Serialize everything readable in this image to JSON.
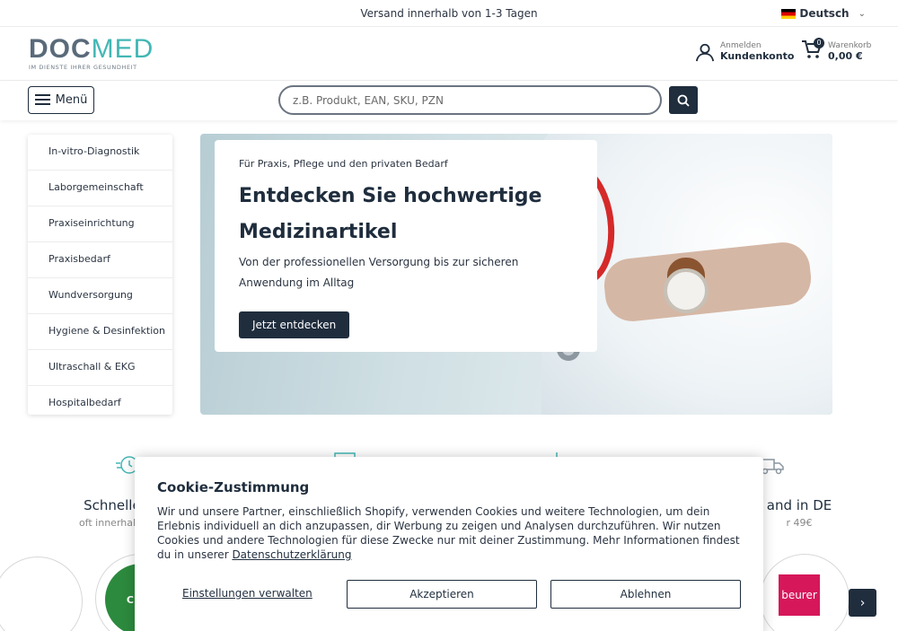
{
  "topbar": {
    "shipping": "Versand innerhalb von 1-3 Tagen",
    "language": "Deutsch"
  },
  "logo": {
    "brand_doc": "DOC",
    "brand_med": "MED",
    "tagline": "IM DIENSTE IHRER GESUNDHEIT"
  },
  "account": {
    "small": "Anmelden",
    "big": "Kundenkonto"
  },
  "cart": {
    "count": "0",
    "small": "Warenkorb",
    "total": "0,00 €"
  },
  "nav": {
    "menu_label": "Menü",
    "search_placeholder": "z.B. Produkt, EAN, SKU, PZN"
  },
  "categories": [
    "In-vitro-Diagnostik",
    "Laborgemeinschaft",
    "Praxiseinrichtung",
    "Praxisbedarf",
    "Wundversorgung",
    "Hygiene & Desinfektion",
    "Ultraschall & EKG",
    "Hospitalbedarf"
  ],
  "hero": {
    "kicker": "Für Praxis, Pflege und den privaten Bedarf",
    "title_line1": "Entdecken Sie hochwertige",
    "title_line2": "Medizinartikel",
    "desc_line1": "Von der professionellen Versorgung bis zur sicheren",
    "desc_line2": "Anwendung im Alltag",
    "cta": "Jetzt entdecken"
  },
  "benefits": [
    {
      "title": "Schneller",
      "sub": "oft innerhalb v"
    },
    {
      "title": "and in DE",
      "sub": "r 49€"
    }
  ],
  "brands": {
    "left_logo": "CEDE",
    "right_logo": "beurer"
  },
  "cookie": {
    "title": "Cookie-Zustimmung",
    "text": "Wir und unsere Partner, einschließlich Shopify, verwenden Cookies und weitere Technologien, um dein Erlebnis individuell an dich anzupassen, dir Werbung zu zeigen und Analysen durchzuführen. Wir nutzen Cookies und andere Technologien für diese Zwecke nur mit deiner Zustimmung. Mehr Informationen findest du in unserer ",
    "link": "Datenschutzerklärung",
    "settings": "Einstellungen verwalten",
    "accept": "Akzeptieren",
    "decline": "Ablehnen"
  },
  "colors": {
    "primary": "#1f2d3d",
    "accent": "#42b7b4",
    "beurer": "#d6175a"
  }
}
